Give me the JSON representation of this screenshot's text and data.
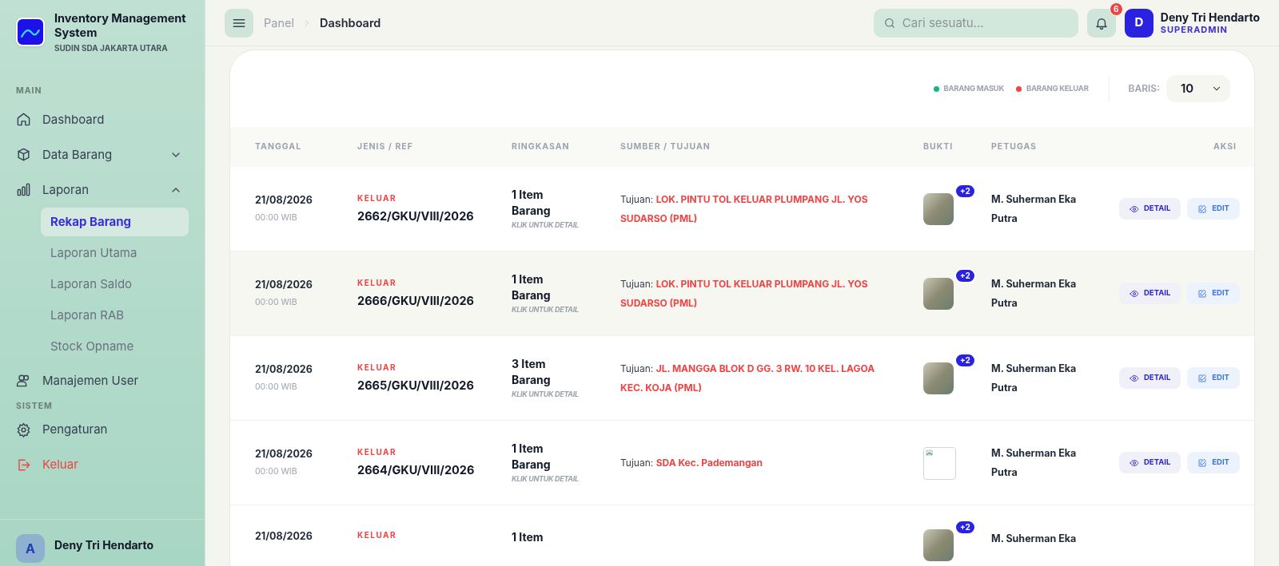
{
  "app": {
    "title": "Inventory Management System",
    "subtitle": "SUDIN SDA JAKARTA UTARA"
  },
  "sidebar": {
    "sections": [
      {
        "label": "MAIN",
        "items": [
          {
            "label": "Dashboard",
            "kind": "link"
          },
          {
            "label": "Data Barang",
            "kind": "group",
            "expanded": false
          },
          {
            "label": "Laporan",
            "kind": "group",
            "expanded": true,
            "children": [
              {
                "label": "Rekap Barang",
                "selected": true
              },
              {
                "label": "Laporan Utama",
                "selected": false
              },
              {
                "label": "Laporan Saldo",
                "selected": false
              },
              {
                "label": "Laporan RAB",
                "selected": false
              },
              {
                "label": "Stock Opname",
                "selected": false
              }
            ]
          },
          {
            "label": "Manajemen User",
            "kind": "link"
          }
        ]
      },
      {
        "label": "SISTEM",
        "items": [
          {
            "label": "Pengaturan",
            "kind": "link"
          },
          {
            "label": "Keluar",
            "kind": "danger"
          }
        ]
      }
    ],
    "user": {
      "initial": "A",
      "name": "Deny Tri Hendarto"
    }
  },
  "header": {
    "breadcrumb": [
      "Panel",
      "Dashboard"
    ],
    "search": {
      "placeholder": "Cari sesuatu..."
    },
    "notifications": "6",
    "user": {
      "initial": "D",
      "name": "Deny Tri Hendarto",
      "role": "SUPERADMIN"
    }
  },
  "legend": [
    {
      "label": "BARANG MASUK",
      "color": "#10b981"
    },
    {
      "label": "BARANG KELUAR",
      "color": "#ef4444"
    }
  ],
  "rows_select": {
    "label": "BARIS:",
    "value": "10"
  },
  "table": {
    "columns": [
      "TANGGAL",
      "JENIS / REF",
      "RINGKASAN",
      "SUMBER / TUJUAN",
      "BUKTI",
      "PETUGAS",
      "AKSI"
    ],
    "rows": [
      {
        "date": "21/08/2026",
        "time": "00:00 WIB",
        "type": "KELUAR",
        "kind": "out",
        "ref": "2662/GKU/VIII/2026",
        "summary": "1 Item Barang",
        "hint": "KLIK UNTUK DETAIL",
        "dest_label": "Tujuan:",
        "destination": "LOK. PINTU TOL KELUAR PLUMPANG JL. YOS SUDARSO (PML)",
        "proof": {
          "kind": "photo",
          "extra": "+2"
        },
        "officer": "M. Suherman Eka Putra",
        "actions": [
          "DETAIL",
          "EDIT"
        ],
        "hovered": false
      },
      {
        "date": "21/08/2026",
        "time": "00:00 WIB",
        "type": "KELUAR",
        "kind": "out",
        "ref": "2666/GKU/VIII/2026",
        "summary": "1 Item Barang",
        "hint": "KLIK UNTUK DETAIL",
        "dest_label": "Tujuan:",
        "destination": "LOK. PINTU TOL KELUAR PLUMPANG JL. YOS SUDARSO (PML)",
        "proof": {
          "kind": "photo",
          "extra": "+2"
        },
        "officer": "M. Suherman Eka Putra",
        "actions": [
          "DETAIL",
          "EDIT"
        ],
        "hovered": true
      },
      {
        "date": "21/08/2026",
        "time": "00:00 WIB",
        "type": "KELUAR",
        "kind": "out",
        "ref": "2665/GKU/VIII/2026",
        "summary": "3 Item Barang",
        "hint": "KLIK UNTUK DETAIL",
        "dest_label": "Tujuan:",
        "destination": "JL. MANGGA BLOK D GG. 3 RW. 10 KEL. LAGOA KEC. KOJA (PML)",
        "proof": {
          "kind": "photo",
          "extra": "+2"
        },
        "officer": "M. Suherman Eka Putra",
        "actions": [
          "DETAIL",
          "EDIT"
        ],
        "hovered": false
      },
      {
        "date": "21/08/2026",
        "time": "00:00 WIB",
        "type": "KELUAR",
        "kind": "out",
        "ref": "2664/GKU/VIII/2026",
        "summary": "1 Item Barang",
        "hint": "KLIK UNTUK DETAIL",
        "dest_label": "Tujuan:",
        "destination": "SDA Kec. Pademangan",
        "proof": {
          "kind": "broken"
        },
        "officer": "M. Suherman Eka Putra",
        "actions": [
          "DETAIL",
          "EDIT"
        ],
        "hovered": false
      },
      {
        "date": "21/08/2026",
        "type": "KELUAR",
        "kind": "out",
        "summary": "1 Item",
        "proof": {
          "kind": "photo",
          "extra": "+2"
        },
        "officer": "M. Suherman Eka",
        "hovered": false
      }
    ]
  }
}
